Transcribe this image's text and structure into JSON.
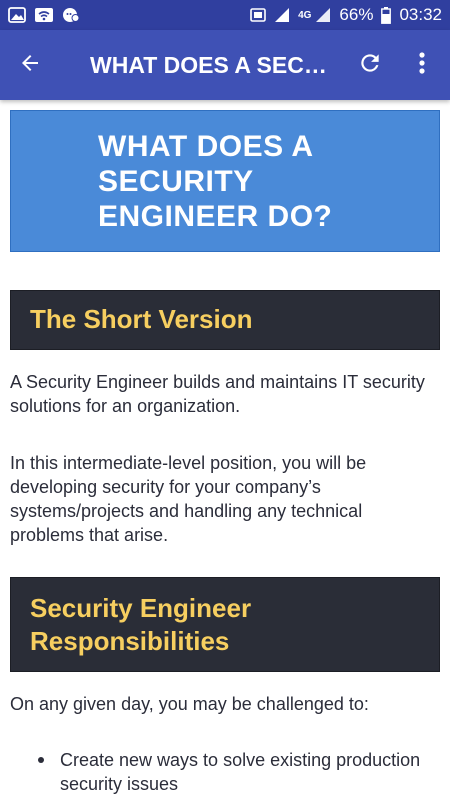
{
  "status_bar": {
    "network_type": "4G",
    "battery_percent": "66%",
    "time": "03:32",
    "icons": [
      "photo-icon",
      "wifi-icon",
      "chat-icon",
      "screenshot-icon",
      "signal-icon",
      "battery-icon"
    ]
  },
  "app_bar": {
    "title": "WHAT DOES A SEC…",
    "back_icon": "arrow-left-icon",
    "refresh_icon": "refresh-icon",
    "menu_icon": "more-vert-icon"
  },
  "article": {
    "hero_lines": [
      "WHAT DOES A",
      "SECURITY",
      "ENGINEER DO?"
    ],
    "section1_title": "The Short Version",
    "para1": "A Security Engineer builds and maintains IT security solutions for an organization.",
    "para2": "In this intermediate-level position, you will be developing security for your company’s systems/projects and handling any technical problems that arise.",
    "section2_lines": [
      "Security Engineer",
      "Responsibilities"
    ],
    "para3": "On any given day, you may be challenged to:",
    "bullets": [
      "Create new ways to solve existing production security issues"
    ]
  },
  "colors": {
    "status_bar": "#303f9f",
    "app_bar": "#3f51b5",
    "hero_bg": "#4a8ad8",
    "section_bg": "#2a2d37",
    "section_text": "#f7cf60",
    "body_text": "#2b2d3a"
  }
}
